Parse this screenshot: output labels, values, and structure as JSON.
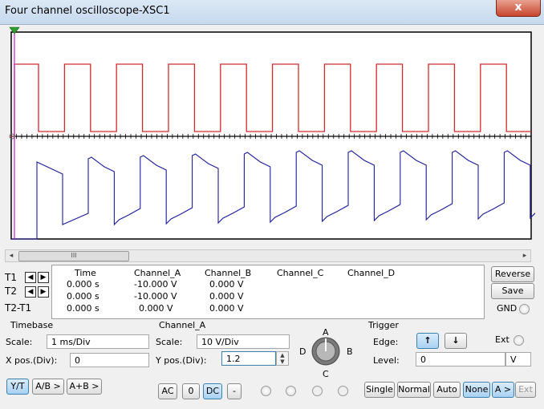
{
  "window": {
    "title": "Four channel oscilloscope-XSC1",
    "close_label": "x"
  },
  "scrollbar": {
    "thumb_label": "III",
    "left_arrow": "◂",
    "right_arrow": "▸"
  },
  "readout": {
    "rows": [
      "T1",
      "T2",
      "T2-T1"
    ],
    "columns": [
      "Time",
      "Channel_A",
      "Channel_B",
      "Channel_C",
      "Channel_D"
    ],
    "values": [
      [
        "0.000 s",
        "-10.000 V",
        "0.000 V"
      ],
      [
        "0.000 s",
        "-10.000 V",
        "0.000 V"
      ],
      [
        "0.000 s",
        "0.000 V",
        "0.000 V"
      ]
    ]
  },
  "side_buttons": {
    "reverse": "Reverse",
    "save": "Save",
    "gnd": "GND"
  },
  "timebase": {
    "title": "Timebase",
    "scale_label": "Scale:",
    "scale_value": "1 ms/Div",
    "xpos_label": "X pos.(Div):",
    "xpos_value": "0",
    "yt": "Y/T",
    "ab": "A/B >",
    "apb": "A+B >"
  },
  "channel": {
    "title": "Channel_A",
    "scale_label": "Scale:",
    "scale_value": "10  V/Div",
    "ypos_label": "Y pos.(Div):",
    "ypos_value": "1.2",
    "ac": "AC",
    "zero": "0",
    "dc": "DC",
    "minus": "-",
    "knob": {
      "a": "A",
      "b": "B",
      "c": "C",
      "d": "D"
    }
  },
  "trigger": {
    "title": "Trigger",
    "edge_label": "Edge:",
    "ext_label": "Ext",
    "level_label": "Level:",
    "level_value": "0",
    "level_unit": "V",
    "single": "Single",
    "normal": "Normal",
    "auto": "Auto",
    "none": "None",
    "a_gt": "A >",
    "ext_btn": "Ext"
  },
  "colors": {
    "channel_a": "#d42a2a",
    "channel_b": "#1d1d9e",
    "grid": "#000000",
    "t1_marker": "#d018d0"
  }
}
